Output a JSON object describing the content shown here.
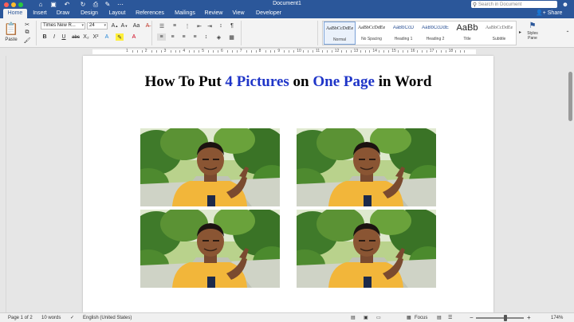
{
  "window": {
    "title": "Document1",
    "search_placeholder": "Search in Document",
    "share_label": "Share"
  },
  "tabs": [
    "Home",
    "Insert",
    "Draw",
    "Design",
    "Layout",
    "References",
    "Mailings",
    "Review",
    "View",
    "Developer"
  ],
  "active_tab": "Home",
  "ribbon": {
    "paste_label": "Paste",
    "font_name": "Times New R...",
    "font_size": "24",
    "styles": [
      {
        "sample": "AaBbCcDdEe",
        "name": "Normal",
        "selected": true
      },
      {
        "sample": "AaBbCcDdEe",
        "name": "No Spacing",
        "selected": false
      },
      {
        "sample": "AaBbCcD",
        "name": "Heading 1",
        "selected": false
      },
      {
        "sample": "AaBbCcDdE",
        "name": "Heading 2",
        "selected": false
      },
      {
        "sample": "AaBb",
        "name": "Title",
        "selected": false
      },
      {
        "sample": "AaBbCcDdEe",
        "name": "Subtitle",
        "selected": false
      }
    ],
    "styles_pane_label": "Styles Pane"
  },
  "document": {
    "title_parts": [
      {
        "text": "How To Put ",
        "color": "#000000"
      },
      {
        "text": "4 Pictures",
        "color": "#1f35c8"
      },
      {
        "text": " on ",
        "color": "#000000"
      },
      {
        "text": "One Page",
        "color": "#1f35c8"
      },
      {
        "text": " in Word",
        "color": "#000000"
      }
    ],
    "picture_count": 4
  },
  "ruler_numbers": [
    "1",
    "2",
    "3",
    "4",
    "5",
    "6",
    "7",
    "8",
    "9",
    "10",
    "11",
    "12",
    "13",
    "14",
    "15",
    "16",
    "17",
    "18"
  ],
  "status": {
    "page": "Page 1 of 2",
    "words": "10 words",
    "language": "English (United States)",
    "focus": "Focus",
    "zoom": "174%",
    "zoom_fraction": 0.62
  },
  "colors": {
    "brand": "#2b579a",
    "title_accent": "#1f35c8"
  }
}
